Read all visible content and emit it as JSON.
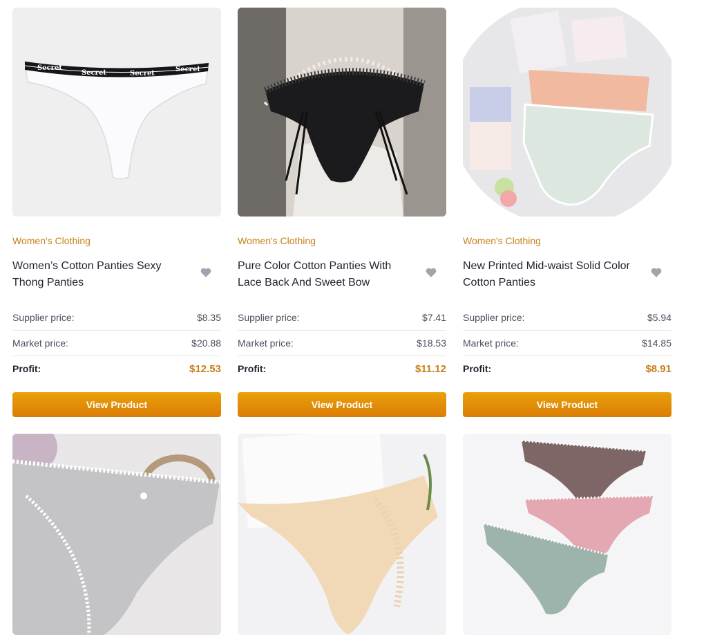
{
  "labels": {
    "supplier": "Supplier price:",
    "market": "Market price:",
    "profit": "Profit:",
    "button": "View Product"
  },
  "colors": {
    "accent": "#c8801a",
    "button_top": "#e8a10a",
    "button_bottom": "#dc7d06",
    "heart": "#a0a4b0"
  },
  "products": [
    {
      "category": "Women's Clothing",
      "title": "Women’s Cotton Panties Sexy Thong Panties",
      "supplier_price": "$8.35",
      "market_price": "$20.88",
      "profit": "$12.53",
      "image_icon": "white-thong-image"
    },
    {
      "category": "Women's Clothing",
      "title": "Pure Color Cotton Panties With Lace Back And Sweet Bow",
      "supplier_price": "$7.41",
      "market_price": "$18.53",
      "profit": "$11.12",
      "image_icon": "black-lace-panty-image"
    },
    {
      "category": "Women's Clothing",
      "title": "New Printed Mid-waist Solid Color Cotton Panties",
      "supplier_price": "$5.94",
      "market_price": "$14.85",
      "profit": "$8.91",
      "image_icon": "pastel-panties-image"
    },
    {
      "image_icon": "gray-lace-panty-image"
    },
    {
      "image_icon": "beige-lace-thong-image"
    },
    {
      "image_icon": "three-thongs-image"
    }
  ]
}
